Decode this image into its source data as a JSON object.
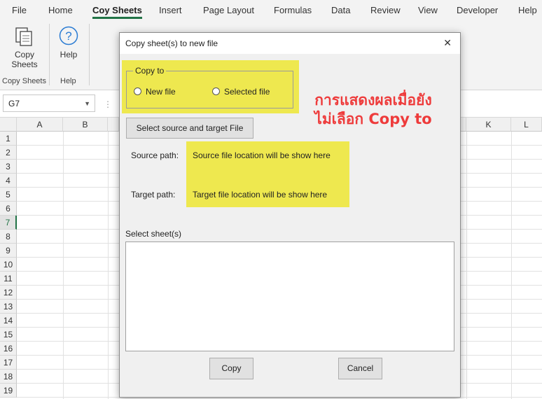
{
  "ribbon_tabs": [
    "File",
    "Home",
    "Coy Sheets",
    "Insert",
    "Page Layout",
    "Formulas",
    "Data",
    "Review",
    "View",
    "Developer",
    "Help"
  ],
  "active_tab": "Coy Sheets",
  "ribbon": {
    "copy_sheets_label_1": "Copy",
    "copy_sheets_label_2": "Sheets",
    "help_label": "Help",
    "group_copy_sheets": "Copy Sheets",
    "group_help": "Help"
  },
  "name_box": {
    "value": "G7"
  },
  "columns": [
    "A",
    "B",
    "",
    "",
    "",
    "",
    "",
    "",
    "",
    "",
    "K",
    "L"
  ],
  "rows": [
    "1",
    "2",
    "3",
    "4",
    "5",
    "6",
    "7",
    "8",
    "9",
    "10",
    "11",
    "12",
    "13",
    "14",
    "15",
    "16",
    "17",
    "18",
    "19"
  ],
  "active_row": "7",
  "dialog": {
    "title": "Copy sheet(s) to new file",
    "close_glyph": "✕",
    "copy_to_legend": "Copy to",
    "radio_new_file": "New file",
    "radio_selected_file": "Selected file",
    "select_button": "Select source and target  File",
    "source_path_label": "Source path:",
    "source_path_value": "Source file location will be show here",
    "target_path_label": "Target path:",
    "target_path_value": "Target file location will be show here",
    "select_sheets_label": "Select sheet(s)",
    "copy_button": "Copy",
    "cancel_button": "Cancel"
  },
  "annotation": {
    "line1": "การแสดงผลเมื่อยัง",
    "line2": "ไม่เลือก Copy to"
  },
  "colors": {
    "highlight": "#eee84f",
    "annotation": "#ee3b3b",
    "excel_green": "#217346"
  }
}
